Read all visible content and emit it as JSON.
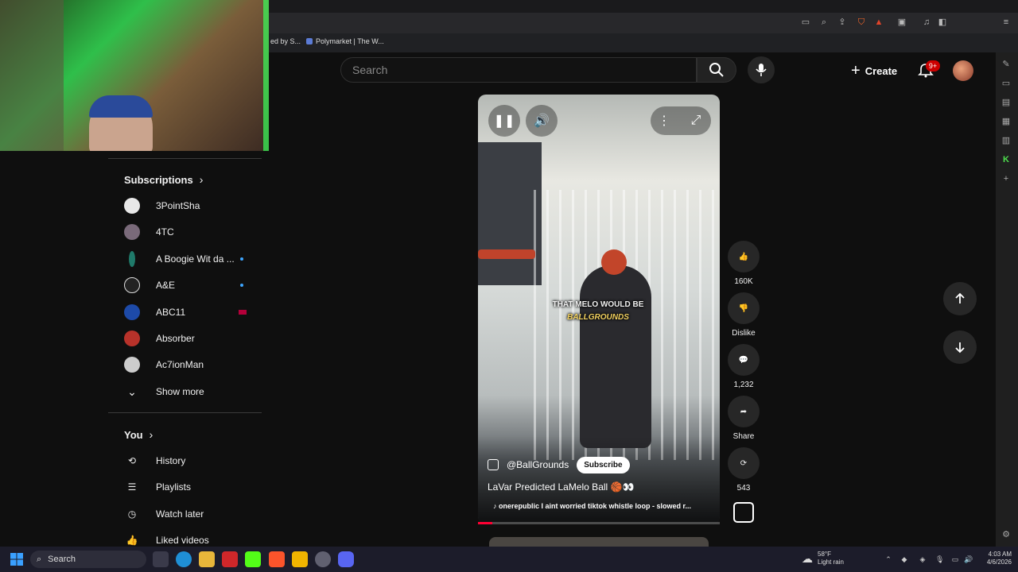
{
  "browser": {
    "bookmarks": [
      "ed by S...",
      "Polymarket | The W..."
    ]
  },
  "header": {
    "search_placeholder": "Search",
    "create_label": "Create",
    "notifications_badge": "9+"
  },
  "sidebar": {
    "subscriptions_title": "Subscriptions",
    "subscriptions": [
      {
        "label": "3PointSha",
        "indicator": "none",
        "color": "#e8e8e8"
      },
      {
        "label": "4TC",
        "indicator": "none",
        "color": "#7a6a7a"
      },
      {
        "label": "A Boogie Wit da ...",
        "indicator": "dot",
        "color": "#1f7a6a"
      },
      {
        "label": "A&E",
        "indicator": "dot",
        "color": "#222222"
      },
      {
        "label": "ABC11",
        "indicator": "live",
        "color": "#1d4aa8"
      },
      {
        "label": "Absorber",
        "indicator": "none",
        "color": "#b8322a"
      },
      {
        "label": "Ac7ionMan",
        "indicator": "none",
        "color": "#cccccc"
      }
    ],
    "show_more": "Show more",
    "you_title": "You",
    "you_items": [
      {
        "label": "History",
        "icon": "history-icon"
      },
      {
        "label": "Playlists",
        "icon": "playlists-icon"
      },
      {
        "label": "Watch later",
        "icon": "clock-icon"
      },
      {
        "label": "Liked videos",
        "icon": "thumbs-up-icon"
      }
    ]
  },
  "short": {
    "caption_line1": "THAT MELO WOULD BE",
    "caption_line2": "BALLGROUNDS",
    "channel": "@BallGrounds",
    "subscribe_label": "Subscribe",
    "title": "LaVar Predicted LaMelo Ball 🏀👀",
    "music": "onerepublic I aint worried tiktok whistle loop - slowed r...",
    "progress": 0.06
  },
  "actions": {
    "likes": "160K",
    "dislike": "Dislike",
    "comments": "1,232",
    "share": "Share",
    "remix": "543"
  },
  "taskbar": {
    "search": "Search",
    "weather_temp": "58°F",
    "weather_desc": "Light rain",
    "time": "4:03 AM",
    "date": "4/6/2026"
  },
  "colors": {
    "accent_red": "#ff0033",
    "badge_red": "#cc0000",
    "caption_yellow": "#f3d25f"
  }
}
